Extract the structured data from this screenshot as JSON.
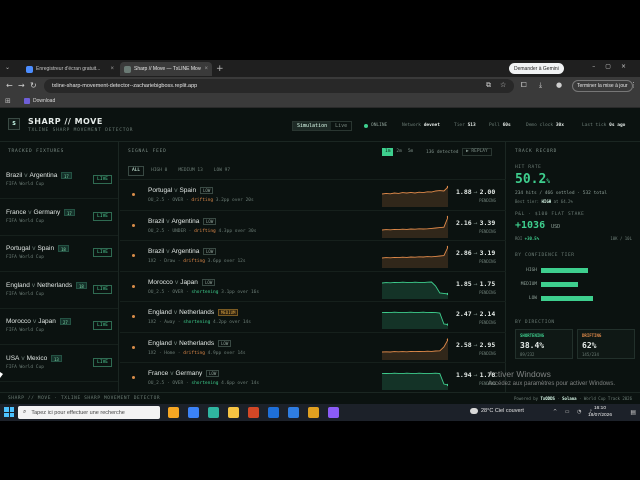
{
  "browser": {
    "tabs": [
      {
        "label": "Enregistreur d'écran gratuit...",
        "color": "#4c8dff"
      },
      {
        "label": "Sharp // Move — TxLINE Move...",
        "color": "#6a7a74"
      }
    ],
    "gemini_label": "Demander à Gemini",
    "url": "txline-sharp-movement-detector--zachariebigboss.replit.app",
    "update_label": "Terminer la mise à jour",
    "bookmark_download": "Download"
  },
  "header": {
    "logo": "S",
    "brand": "SHARP // MOVE",
    "subtitle": "TXLINE SHARP MOVEMENT DETECTOR",
    "modes": [
      "Simulation",
      "Live"
    ],
    "status": "ONLINE",
    "network_label": "Network",
    "network_value": "devnet",
    "tier_label": "Tier",
    "tier_value": "S13",
    "poll_label": "Poll",
    "poll_value": "60s",
    "clock_label": "Demo clock",
    "clock_value": "30x",
    "last_tick_label": "Last tick",
    "last_tick_value": "0s ago"
  },
  "fixtures": {
    "title": "TRACKED FIXTURES",
    "live_label": "LIVE",
    "items": [
      {
        "home": "Brazil",
        "away": "Argentina",
        "count": "17",
        "competition": "FIFA World Cup"
      },
      {
        "home": "France",
        "away": "Germany",
        "count": "17",
        "competition": "FIFA World Cup"
      },
      {
        "home": "Portugal",
        "away": "Spain",
        "count": "18",
        "competition": "FIFA World Cup"
      },
      {
        "home": "England",
        "away": "Netherlands",
        "count": "18",
        "competition": "FIFA World Cup"
      },
      {
        "home": "Morocco",
        "away": "Japan",
        "count": "27",
        "competition": "FIFA World Cup"
      },
      {
        "home": "USA",
        "away": "Mexico",
        "count": "13",
        "competition": "FIFA World Cup"
      }
    ]
  },
  "feed": {
    "title": "SIGNAL FEED",
    "windows": [
      "1m",
      "2m",
      "5m"
    ],
    "detected": "136 detected",
    "replay": "▶ REPLAY",
    "filters": [
      "ALL",
      "HIGH 0",
      "MEDIUM 13",
      "LOW 97"
    ],
    "signals": [
      {
        "home": "Portugal",
        "away": "Spain",
        "confidence": "LOW",
        "market": "OU_2.5 · OVER ·",
        "direction": "drifting",
        "detail": "3.2pp over 20s",
        "odds_from": "1.88",
        "odds_to": "2.00",
        "status": "PENDING",
        "trend": "drift",
        "series": [
          0.55,
          0.58,
          0.56,
          0.6,
          0.58,
          0.62,
          0.6,
          0.63,
          0.6,
          0.64,
          0.62,
          0.66,
          0.65,
          0.7,
          0.72,
          0.7,
          0.9
        ]
      },
      {
        "home": "Brazil",
        "away": "Argentina",
        "confidence": "LOW",
        "market": "OU_2.5 · UNDER ·",
        "direction": "drifting",
        "detail": "4.3pp over 30s",
        "odds_from": "2.16",
        "odds_to": "3.39",
        "status": "PENDING",
        "trend": "drift",
        "series": [
          0.3,
          0.32,
          0.31,
          0.33,
          0.32,
          0.34,
          0.33,
          0.35,
          0.34,
          0.36,
          0.35,
          0.36,
          0.38,
          0.4,
          0.42,
          0.44,
          0.95
        ]
      },
      {
        "home": "Brazil",
        "away": "Argentina",
        "confidence": "LOW",
        "market": "1X2 · Draw ·",
        "direction": "drifting",
        "detail": "3.6pp over 12s",
        "odds_from": "2.86",
        "odds_to": "3.19",
        "status": "PENDING",
        "trend": "drift",
        "series": [
          0.4,
          0.42,
          0.41,
          0.43,
          0.42,
          0.44,
          0.43,
          0.45,
          0.44,
          0.46,
          0.45,
          0.47,
          0.46,
          0.48,
          0.5,
          0.52,
          0.95
        ]
      },
      {
        "home": "Morocco",
        "away": "Japan",
        "confidence": "LOW",
        "market": "OU_2.5 · OVER ·",
        "direction": "shortening",
        "detail": "3.1pp over 16s",
        "odds_from": "1.85",
        "odds_to": "1.75",
        "status": "PENDING",
        "trend": "short",
        "series": [
          0.7,
          0.72,
          0.71,
          0.73,
          0.72,
          0.74,
          0.73,
          0.72,
          0.74,
          0.73,
          0.72,
          0.74,
          0.75,
          0.55,
          0.2,
          0.18,
          0.15
        ]
      },
      {
        "home": "England",
        "away": "Netherlands",
        "confidence": "MEDIUM",
        "market": "1X2 · Away ·",
        "direction": "shortening",
        "detail": "4.2pp over 14s",
        "odds_from": "2.47",
        "odds_to": "2.14",
        "status": "PENDING",
        "trend": "short",
        "series": [
          0.72,
          0.73,
          0.72,
          0.74,
          0.73,
          0.72,
          0.73,
          0.74,
          0.72,
          0.73,
          0.74,
          0.72,
          0.73,
          0.72,
          0.7,
          0.15,
          0.12
        ]
      },
      {
        "home": "England",
        "away": "Netherlands",
        "confidence": "LOW",
        "market": "1X2 · Home ·",
        "direction": "drifting",
        "detail": "4.9pp over 14s",
        "odds_from": "2.58",
        "odds_to": "2.95",
        "status": "PENDING",
        "trend": "drift",
        "series": [
          0.3,
          0.31,
          0.3,
          0.32,
          0.31,
          0.32,
          0.31,
          0.33,
          0.32,
          0.33,
          0.32,
          0.34,
          0.33,
          0.35,
          0.36,
          0.55,
          0.92
        ]
      },
      {
        "home": "France",
        "away": "Germany",
        "confidence": "LOW",
        "market": "OU_2.5 · OVER ·",
        "direction": "shortening",
        "detail": "4.6pp over 14s",
        "odds_from": "1.94",
        "odds_to": "1.78",
        "status": "PENDING",
        "trend": "short",
        "series": [
          0.72,
          0.73,
          0.72,
          0.74,
          0.73,
          0.72,
          0.74,
          0.73,
          0.72,
          0.74,
          0.73,
          0.72,
          0.73,
          0.74,
          0.72,
          0.2,
          0.15
        ]
      }
    ]
  },
  "track": {
    "title": "TRACK RECORD",
    "hit_rate_label": "HIT RATE",
    "hit_rate_value": "50.2",
    "hit_rate_unit": "%",
    "hit_detail": "234 hits / 466 settled · 532 total",
    "best_tier_label": "Best tier:",
    "best_tier_value": "HIGH",
    "best_tier_rest": "at 64.2%",
    "pnl_label": "P&L · $100 FLAT STAKE",
    "pnl_value": "+1036",
    "pnl_unit": "USD",
    "roi_label": "ROI",
    "roi_value": "+30.5%",
    "roi_range": "10K / 10L",
    "tier_section": "BY CONFIDENCE TIER",
    "tiers": [
      {
        "name": "HIGH",
        "level": 0.78
      },
      {
        "name": "MEDIUM",
        "level": 0.62
      },
      {
        "name": "LOW",
        "level": 0.86
      }
    ],
    "direction_section": "BY DIRECTION",
    "directions": [
      {
        "name": "SHORTENING",
        "value": "38.4%",
        "sub": "89/232",
        "color": "#3ecf8e"
      },
      {
        "name": "DRIFTING",
        "value": "62%",
        "sub": "145/234",
        "color": "#e08a4a"
      }
    ]
  },
  "footer": {
    "left": "SHARP // MOVE · TXLINE SHARP MOVEMENT DETECTOR",
    "powered": "Powered by",
    "brand1": "TxODDS",
    "brand2": "Solana",
    "right": "World Cup Track 2026"
  },
  "watermark": {
    "title": "Activer Windows",
    "sub": "Accédez aux paramètres pour activer Windows."
  },
  "taskbar": {
    "search_placeholder": "Tapez ici pour effectuer une recherche",
    "weather": "28°C  Ciel couvert",
    "time": "16:10",
    "date": "18/07/2026",
    "apps": [
      "#f5a623",
      "#3b82f6",
      "#2fb5a0",
      "#f6c343",
      "#d24726",
      "#1e6fd8",
      "#2f7de1",
      "#e0a020",
      "#8b5cf6"
    ]
  },
  "colors": {
    "accent": "#3ecf8e",
    "drift": "#e08a4a",
    "bg": "#0b1210"
  }
}
